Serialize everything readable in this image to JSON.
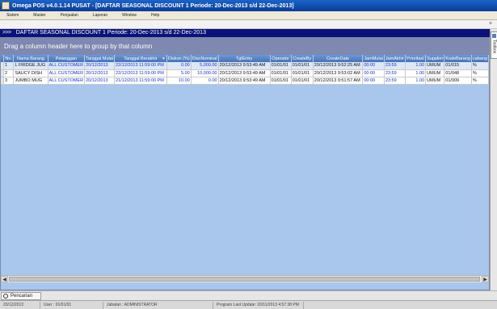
{
  "window": {
    "title": "Omega POS v4.0.1.14 PUSAT - [DAFTAR SEASONAL DISCOUNT 1 Periode: 20-Dec-2013 s/d 22-Dec-2013]"
  },
  "menu": {
    "items": [
      "Sistem",
      "Master",
      "Penjualan",
      "Laporan",
      "Window",
      "Help"
    ]
  },
  "form": {
    "header_arrows": ">>>",
    "header_title": "DAFTAR SEASONAL DISCOUNT 1 Periode: 20-Dec-2013 s/d 22-Dec-2013"
  },
  "side": {
    "toolbox_label": "Toolbox"
  },
  "grid": {
    "group_hint": "Drag a column header here to group by that column",
    "columns": [
      "No.",
      "Nama Barang",
      "Pelanggan",
      "Tanggal Mulai",
      "Tanggal Berakhir",
      "Diskon (%)",
      "DiscNominal",
      "TglEntry",
      "Operator",
      "CreateBy",
      "CreateDate",
      "JamMulai",
      "JamAkhir",
      "PrioritasI",
      "Supplier",
      "KodeBarang",
      "cabang"
    ],
    "rows": [
      [
        "1",
        "L FRIDGE JUG",
        "ALL CUSTOMER",
        "20/12/2013",
        "22/12/2013 11:59:00 PM",
        "0.00",
        "5,000.00",
        "20/12/2013 9:53:49 AM",
        "01/01/01",
        "01/01/01",
        "20/12/2013 9:52:25 AM",
        "00:00",
        "23:59",
        "1.00",
        "UMUM",
        "01/015",
        "%"
      ],
      [
        "2",
        "SAUCY DISH",
        "ALL CUSTOMER",
        "20/12/2013",
        "22/12/2013 11:59:00 PM",
        "5.00",
        "10,000.00",
        "20/12/2013 9:53:49 AM",
        "01/01/01",
        "01/01/01",
        "20/12/2013 9:53:02 AM",
        "00:00",
        "23:59",
        "1.00",
        "UMUM",
        "01/048",
        "%"
      ],
      [
        "3",
        "JUMBO MUG",
        "ALL CUSTOMER",
        "20/12/2013",
        "21/12/2013 11:59:00 PM",
        "10.00",
        "0.00",
        "20/12/2013 9:53:49 AM",
        "01/01/01",
        "01/01/01",
        "20/12/2013 9:51:57 AM",
        "00:00",
        "23:59",
        "1.00",
        "UMUM",
        "01/009",
        "%"
      ]
    ]
  },
  "bottom": {
    "search_label": "Pencarian"
  },
  "status": {
    "date": "20/12/2013",
    "user": "User : 01/01/01",
    "jabatan": "Jabatan : ADMINISTRATOR",
    "last_update": "Program Last Update: 20/11/2013 4:57:38 PM"
  }
}
